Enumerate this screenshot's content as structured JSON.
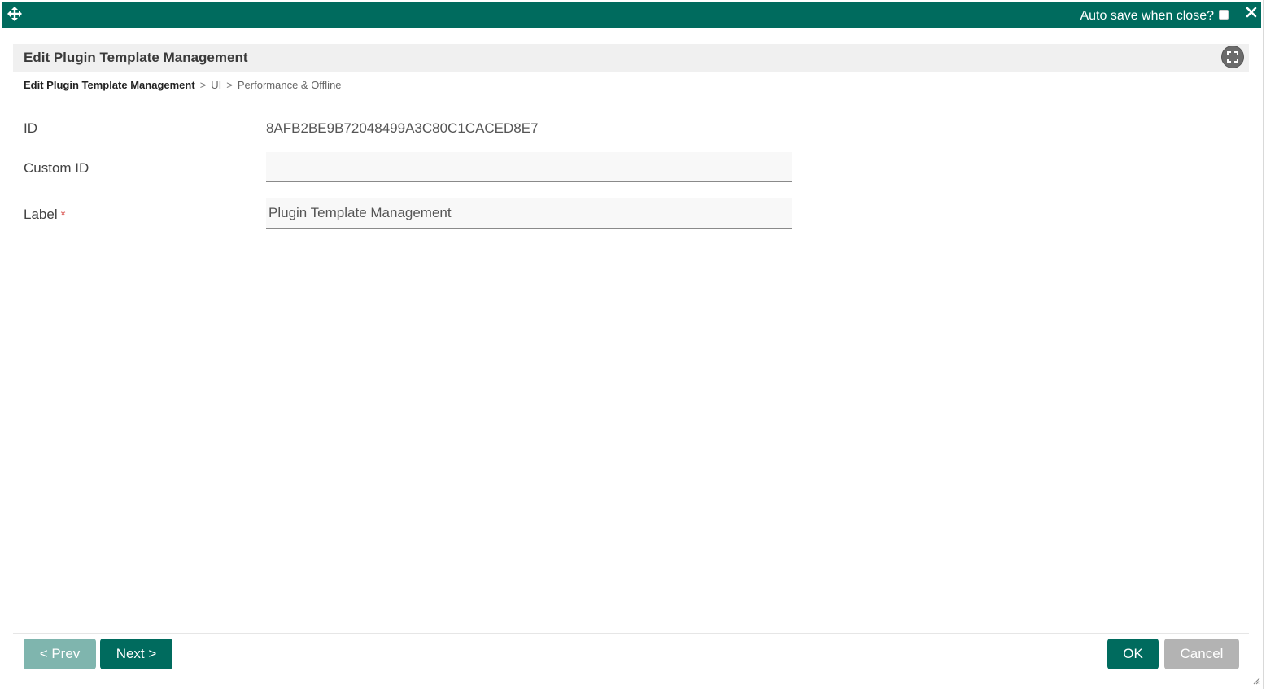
{
  "topbar": {
    "autosave_label": "Auto save when close?",
    "autosave_checked": false,
    "background": "#006b5e"
  },
  "icons": {
    "move": "move-arrows-icon",
    "close": "close-icon",
    "fullscreen": "fullscreen-icon",
    "resize": "resize-handle-icon"
  },
  "panel": {
    "title": "Edit Plugin Template Management"
  },
  "breadcrumb": {
    "root": "Edit Plugin Template Management",
    "separator": ">",
    "items": [
      "UI",
      "Performance & Offline"
    ]
  },
  "form": {
    "id_label": "ID",
    "id_value": "8AFB2BE9B72048499A3C80C1CACED8E7",
    "custom_id_label": "Custom ID",
    "custom_id_value": "",
    "label_label": "Label",
    "label_required_marker": "*",
    "label_value": "Plugin Template Management"
  },
  "footer": {
    "prev_label": "< Prev",
    "next_label": "Next >",
    "ok_label": "OK",
    "cancel_label": "Cancel"
  },
  "colors": {
    "primary": "#006b5e",
    "primary_disabled": "#7fb5ae",
    "cancel": "#b3b3b3",
    "required": "#d9534f"
  }
}
